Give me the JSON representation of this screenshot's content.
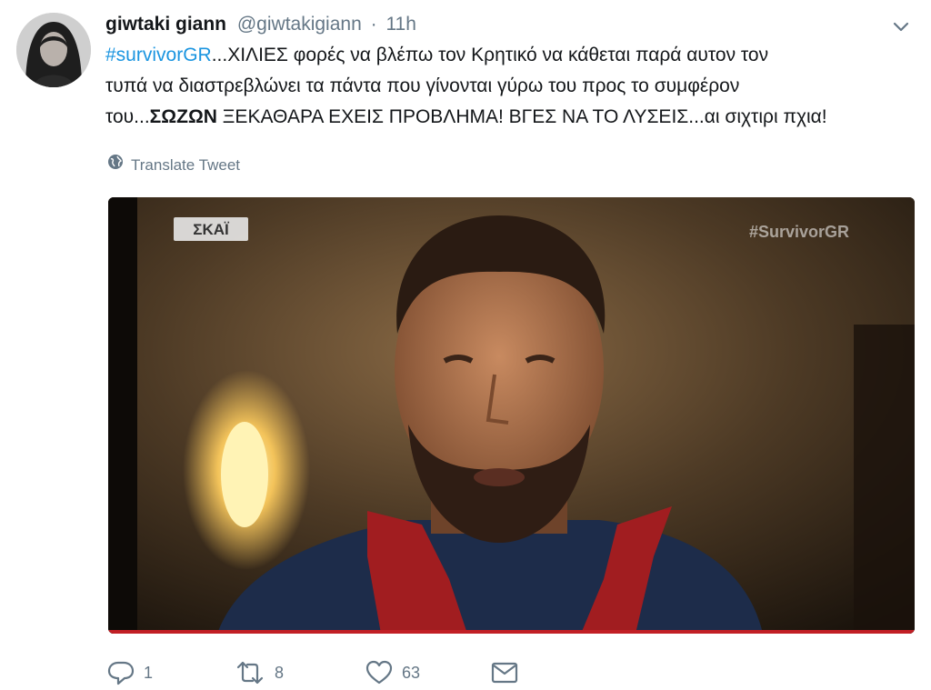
{
  "user": {
    "display_name": "giwtaki giann",
    "handle": "@giwtakigiann",
    "separator": "·",
    "time": "11h"
  },
  "tweet": {
    "hashtag": "#survivorGR",
    "line1": "...ΧΙΛΙΕΣ φορές να βλέπω τον Κρητικό να κάθεται παρά αυτον τον",
    "line2": "τυπά να διαστρεβλώνει τα πάντα που γίνονται γύρω του προς το συμφέρον",
    "line3_pre": "του...",
    "line3_bold": "ΣΩΖΩΝ",
    "line3_post": " ΞΕΚΑΘΑΡΑ ΕΧΕΙΣ ΠΡΟΒΛΗΜΑ! ΒΓΕΣ ΝΑ ΤΟ ΛΥΣΕΙΣ...αι σιχτιρι πχια!"
  },
  "translate": {
    "label": "Translate Tweet",
    "icon": "globe-icon"
  },
  "media": {
    "channel_logo": "ΣΚΑΪ",
    "watermark": "#SurvivorGR"
  },
  "actions": {
    "reply_count": "1",
    "retweet_count": "8",
    "like_count": "63"
  },
  "colors": {
    "link": "#1b95e0",
    "muted": "#657786",
    "text": "#14171a"
  }
}
